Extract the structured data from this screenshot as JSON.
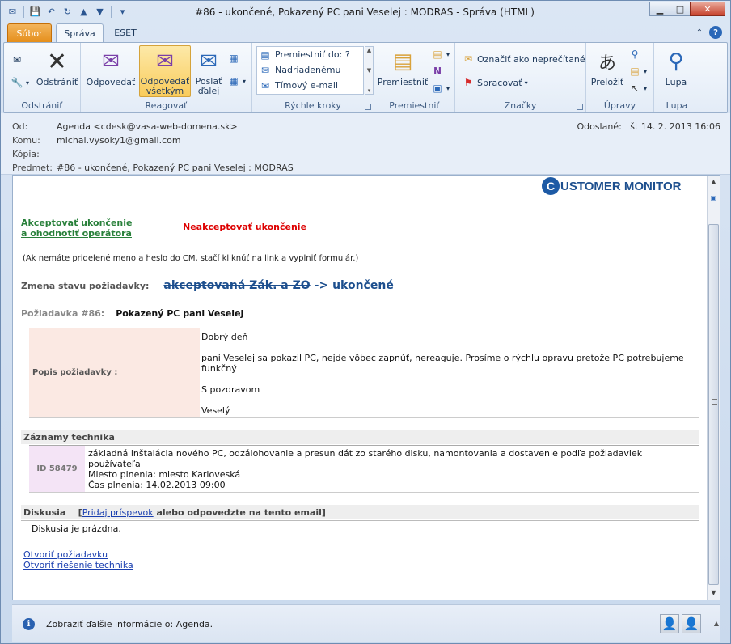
{
  "window": {
    "title": "#86 - ukončené, Pokazený PC pani Veselej : MODRAS  -  Správa (HTML)",
    "minimize": "▁",
    "maximize": "□",
    "close": "✕"
  },
  "tabs": {
    "file": "Súbor",
    "message": "Správa",
    "eset": "ESET"
  },
  "groups": {
    "delete": {
      "label": "Odstrániť",
      "delete_btn": "Odstrániť"
    },
    "respond": {
      "label": "Reagovať",
      "reply": "Odpovedať",
      "reply_all": "Odpovedať všetkým",
      "forward": "Poslať ďalej"
    },
    "quicksteps": {
      "label": "Rýchle kroky",
      "items": [
        "Premiestniť do: ?",
        "Nadriadenému",
        "Tímový e-mail"
      ]
    },
    "move": {
      "label": "Premiestniť",
      "move_btn": "Premiestniť"
    },
    "tags": {
      "label": "Značky",
      "unread": "Označiť ako neprečítané",
      "followup": "Spracovať"
    },
    "editing": {
      "label": "Úpravy",
      "translate": "Preložiť"
    },
    "zoom": {
      "label": "Lupa",
      "zoom_btn": "Lupa"
    }
  },
  "header": {
    "from_label": "Od:",
    "from": "Agenda <cdesk@vasa-web-domena.sk>",
    "to_label": "Komu:",
    "to": "michal.vysoky1@gmail.com",
    "cc_label": "Kópia:",
    "cc": "",
    "subject_label": "Predmet:",
    "subject": "#86 - ukončené, Pokazený PC pani Veselej : MODRAS",
    "sent_label": "Odoslané:",
    "sent": "št 14. 2. 2013 16:06"
  },
  "body": {
    "logo_letter": "C",
    "logo_text": "USTOMER MONITOR",
    "accept_line1": "Akceptovať ukončenie",
    "accept_line2": "a ohodnotiť operátora",
    "reject": "Neakceptovať ukončenie",
    "note": "(Ak nemáte pridelené meno a heslo do CM, stačí kliknúť na link a vyplniť formulár.)",
    "status_label": "Zmena stavu požiadavky:",
    "status_old": "akceptovaná Zák. a ZO",
    "status_new": "-> ukončené",
    "request_num": "Požiadavka #86:",
    "request_title": "Pokazený PC pani Veselej",
    "desc_label": "Popis požiadavky :",
    "desc_greeting": "Dobrý deň",
    "desc_text": "pani Veselej sa pokazil PC, nejde vôbec zapnúť, nereaguje. Prosíme o rýchlu opravu pretože PC potrebujeme funkčný",
    "desc_regards": "S pozdravom",
    "desc_name": "Veselý",
    "tech_header": "Záznamy technika",
    "tech_id": "ID 58479",
    "tech_line1": "základná inštalácia nového PC, odzálohovanie a presun dát zo starého disku, namontovania a dostavenie podľa požiadaviek používateľa",
    "tech_line2": "Miesto plnenia: miesto Karloveská",
    "tech_line3": "Čas plnenia: 14.02.2013 09:00",
    "disc_header": "Diskusia",
    "disc_open": "[",
    "disc_link": "Pridaj príspevok",
    "disc_rest": " alebo odpovedzte na tento email]",
    "disc_empty": "Diskusia je prázdna.",
    "link_open": "Otvoriť požiadavku",
    "link_solution": "Otvoriť riešenie technika"
  },
  "infobar": {
    "text": "Zobraziť ďalšie informácie o: Agenda."
  }
}
